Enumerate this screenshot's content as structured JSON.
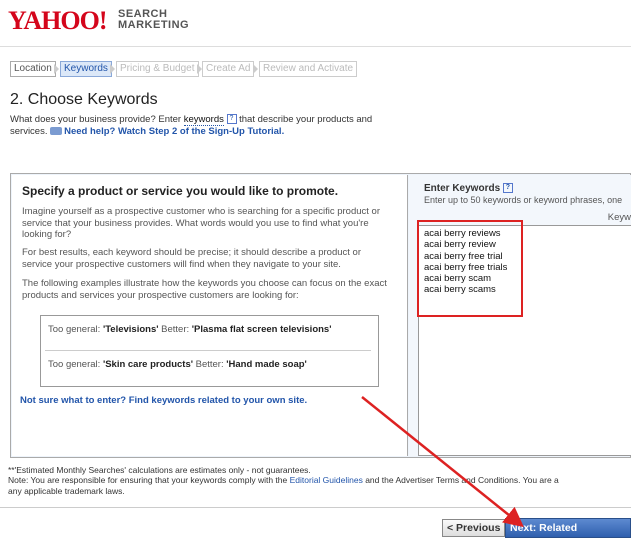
{
  "header": {
    "logo": "YAHOO!",
    "logo_sub1": "SEARCH",
    "logo_sub2": "MARKETING"
  },
  "steps": [
    {
      "label": "Location",
      "state": "done"
    },
    {
      "label": "Keywords",
      "state": "active"
    },
    {
      "label": "Pricing & Budget",
      "state": "inactive"
    },
    {
      "label": "Create Ad",
      "state": "inactive"
    },
    {
      "label": "Review and Activate",
      "state": "inactive"
    }
  ],
  "page": {
    "title": "2. Choose Keywords",
    "desc_pre": "What does your business provide? Enter ",
    "desc_kw": "keywords",
    "desc_q": "?",
    "desc_post": " that describe your products and services.",
    "help_link": "Need help? Watch Step 2 of the Sign-Up Tutorial."
  },
  "promo": {
    "title": "Specify a product or service you would like to promote.",
    "p1": "Imagine yourself as a prospective customer who is searching for a specific product or service that your business provides. What words would you use to find what you're looking for?",
    "p2": "For best results, each keyword should be precise; it should describe a product or service your prospective customers will find when they navigate to your site.",
    "p3": "The following examples illustrate how the keywords you choose can focus on the exact products and services your prospective customers are looking for:",
    "ex1_general_label": "Too general: ",
    "ex1_general": "'Televisions'",
    "ex1_better_label": " Better: ",
    "ex1_better": "'Plasma flat screen televisions'",
    "ex2_general_label": "Too general: ",
    "ex2_general": "'Skin care products'",
    "ex2_better_label": " Better: ",
    "ex2_better": "'Hand made soap'",
    "not_sure": "Not sure what to enter? Find keywords related to your own site."
  },
  "keywords_panel": {
    "label": "Enter Keywords",
    "q": "?",
    "sub": "Enter up to 50 keywords or keyword phrases, one",
    "column_header": "Keyw",
    "keywords": [
      "acai berry reviews",
      "acai berry review",
      "acai berry free trial",
      "acai berry free trials",
      "acai berry scam",
      "acai berry scams"
    ]
  },
  "footer": {
    "note1": "**'Estimated Monthly Searches' calculations are estimates only - not guarantees.",
    "note2_pre": "Note: You are responsible for ensuring that your keywords comply with the ",
    "note2_link": "Editorial Guidelines",
    "note2_mid": " and the Advertiser Terms and Conditions. You are a",
    "note2_end": "any applicable trademark laws."
  },
  "buttons": {
    "prev": "< Previous",
    "next": "Next: Related Keywords"
  },
  "colors": {
    "brand_red": "#d4051b",
    "link_blue": "#2255aa",
    "highlight_red": "#dd2222",
    "primary_button": "#2f5fae"
  }
}
